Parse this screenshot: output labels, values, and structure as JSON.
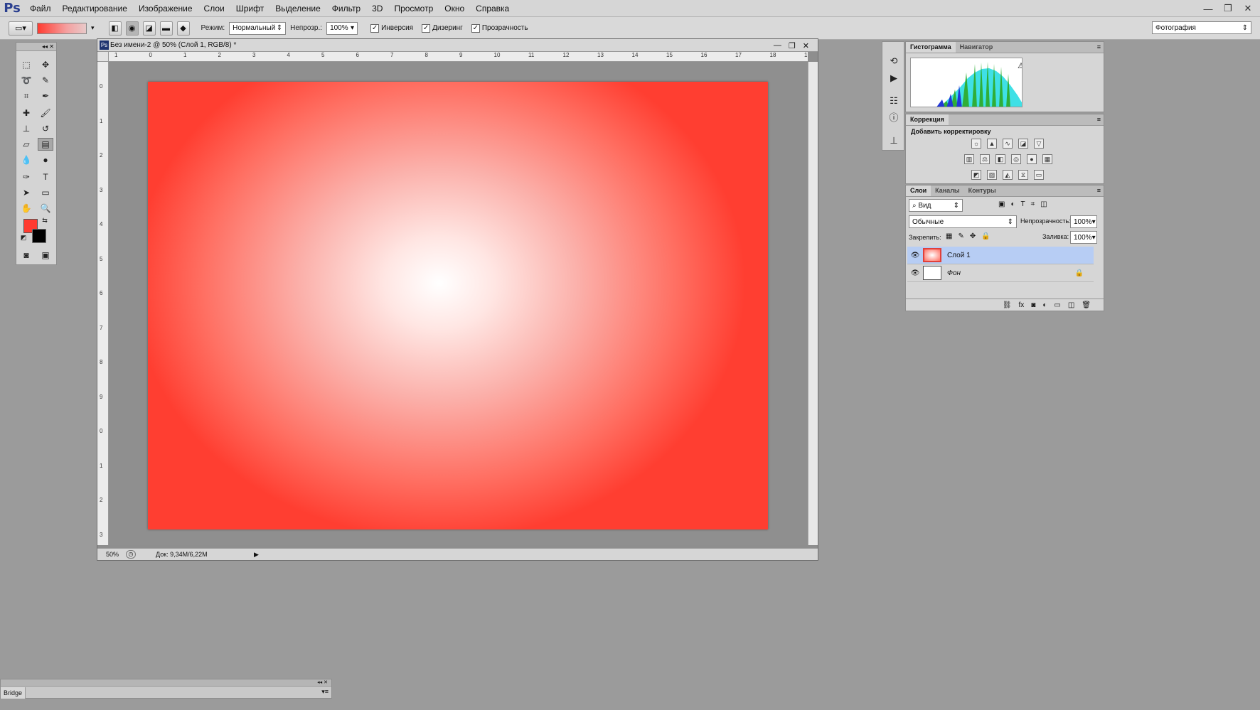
{
  "app": {
    "logo": "Ps"
  },
  "menu": [
    "Файл",
    "Редактирование",
    "Изображение",
    "Слои",
    "Шрифт",
    "Выделение",
    "Фильтр",
    "3D",
    "Просмотр",
    "Окно",
    "Справка"
  ],
  "window_controls": {
    "minimize": "—",
    "restore": "❐",
    "close": "✕"
  },
  "options": {
    "mode_label": "Режим:",
    "mode_value": "Нормальный",
    "opacity_label": "Непрозр.:",
    "opacity_value": "100%",
    "reverse_label": "Инверсия",
    "dither_label": "Дизеринг",
    "transparency_label": "Прозрачность",
    "workspace": "Фотография"
  },
  "document": {
    "title": "Без имени-2 @ 50% (Слой 1, RGB/8) *",
    "zoom": "50%",
    "doc_info": "Док: 9,34M/6,22M",
    "ruler_top": [
      "1",
      "0",
      "1",
      "2",
      "3",
      "4",
      "5",
      "6",
      "7",
      "8",
      "9",
      "10",
      "11",
      "12",
      "13",
      "14",
      "15",
      "16",
      "17",
      "18",
      "1"
    ],
    "ruler_left": [
      "0",
      "1",
      "2",
      "3",
      "4",
      "5",
      "6",
      "7",
      "8",
      "9",
      "0",
      "1",
      "2",
      "3"
    ]
  },
  "panels": {
    "histogram": {
      "tabs": [
        "Гистограмма",
        "Навигатор"
      ]
    },
    "adjustments": {
      "tab": "Коррекция",
      "title": "Добавить корректировку"
    },
    "layers": {
      "tabs": [
        "Слои",
        "Каналы",
        "Контуры"
      ],
      "filter_label": "Вид",
      "blend_mode": "Обычные",
      "opacity_label": "Непрозрачность:",
      "opacity_value": "100%",
      "lock_label": "Закрепить:",
      "fill_label": "Заливка:",
      "fill_value": "100%",
      "items": [
        {
          "name": "Слой 1",
          "selected": true
        },
        {
          "name": "Фон",
          "selected": false
        }
      ]
    }
  },
  "bridge": {
    "label": "Bridge"
  },
  "colors": {
    "foreground": "#ff3b30",
    "background": "#000000",
    "selection": "#b7cdf4"
  }
}
